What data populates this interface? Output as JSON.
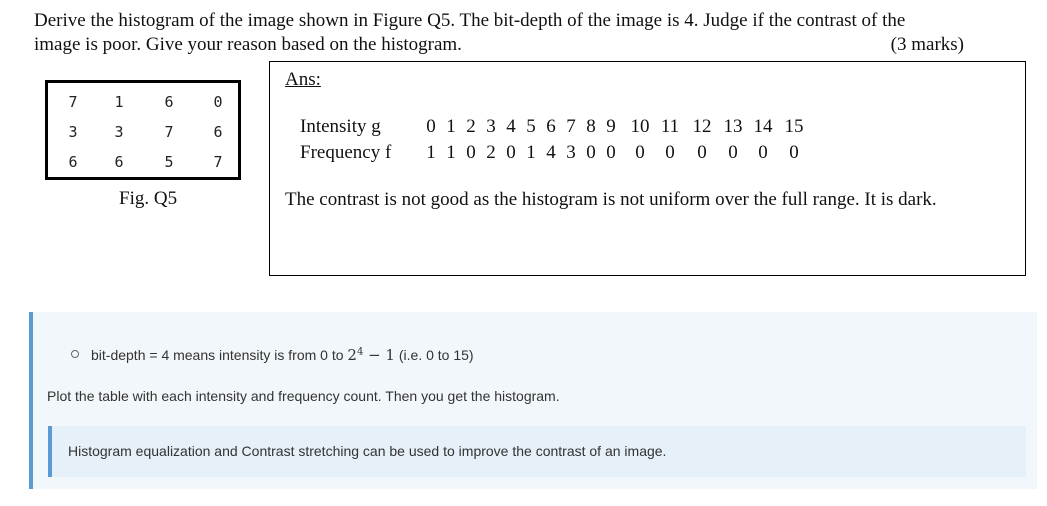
{
  "question": {
    "line1": "Derive the histogram of the image shown in Figure Q5. The bit-depth of the image is 4. Judge if the contrast of the",
    "line2": "image is poor. Give your reason based on the histogram.",
    "marks": "(3 marks)"
  },
  "figure": {
    "matrix": [
      [
        "7",
        "1",
        "6",
        "0"
      ],
      [
        "3",
        "3",
        "7",
        "6"
      ],
      [
        "6",
        "6",
        "5",
        "7"
      ]
    ],
    "caption": "Fig. Q5"
  },
  "answer": {
    "label": "Ans:",
    "intensity_label": "Intensity g",
    "frequency_label": "Frequency f",
    "intensity": [
      "0",
      "1",
      "2",
      "3",
      "4",
      "5",
      "6",
      "7",
      "8",
      "9",
      "10",
      "11",
      "12",
      "13",
      "14",
      "15"
    ],
    "frequency": [
      "1",
      "1",
      "0",
      "2",
      "0",
      "1",
      "4",
      "3",
      "0",
      "0",
      "0",
      "0",
      "0",
      "0",
      "0",
      "0"
    ],
    "conclusion": "The contrast is not good as the histogram is not uniform over the full range. It is dark."
  },
  "notes": {
    "bullet_prefix": "bit-depth = 4 means intensity is from 0 to ",
    "bullet_math": "2",
    "bullet_exp": "4",
    "bullet_math_tail": " − 1",
    "bullet_suffix": " (i.e. 0 to 15)",
    "plot_text": "Plot the table with each intensity and frequency count. Then you get the histogram.",
    "tip_text": "Histogram equalization and Contrast stretching can be used to improve the contrast of an image."
  }
}
